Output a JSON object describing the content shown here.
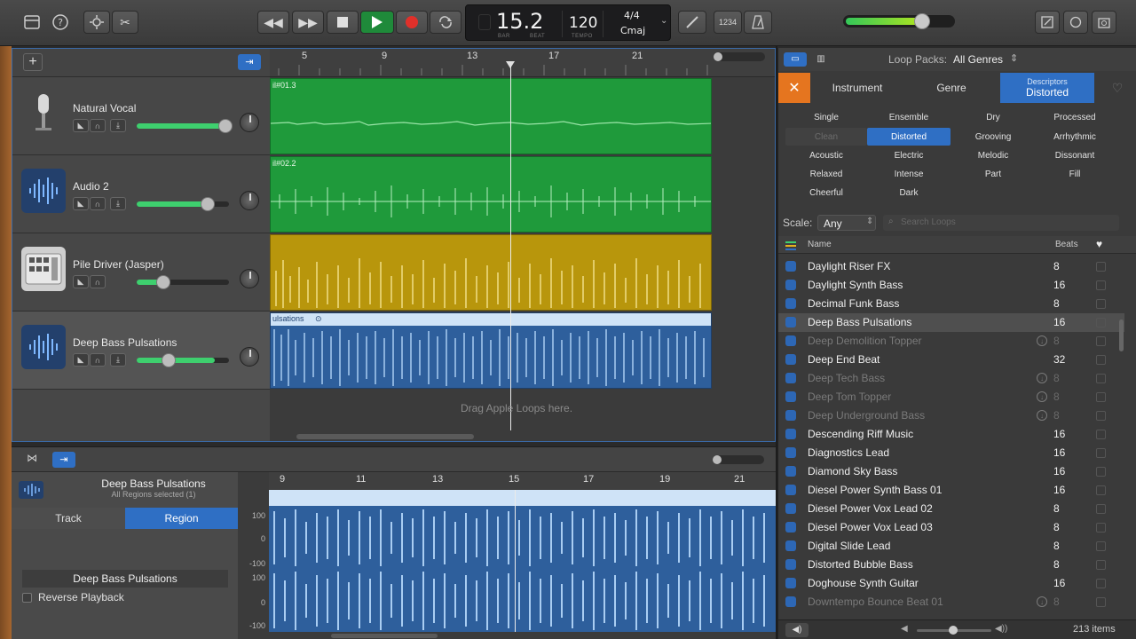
{
  "toolbar": {
    "lcd": {
      "position": "15.2",
      "bar_label": "BAR",
      "beat_label": "BEAT",
      "tempo": "120",
      "tempo_label": "TEMPO",
      "time_signature": "4/4",
      "key": "Cmaj"
    },
    "count_in_label": "1234"
  },
  "tracks": {
    "ruler": [
      "5",
      "9",
      "13",
      "17",
      "21"
    ],
    "items": [
      {
        "name": "Natural Vocal",
        "region": "il#01.3",
        "color": "#1f9a3b"
      },
      {
        "name": "Audio 2",
        "region": "il#02.2",
        "color": "#1f9a3b"
      },
      {
        "name": "Pile Driver (Jasper)",
        "region": "",
        "color": "#b8960c"
      },
      {
        "name": "Deep Bass Pulsations",
        "region": "ulsations",
        "color": "#9dc3ea"
      }
    ],
    "drag_hint": "Drag Apple Loops here."
  },
  "editor": {
    "track_name": "Deep Bass Pulsations",
    "subtitle": "All Regions selected (1)",
    "tab_track": "Track",
    "tab_region": "Region",
    "region_name": "Deep Bass Pulsations",
    "reverse_label": "Reverse Playback",
    "ruler": [
      "9",
      "11",
      "13",
      "15",
      "17",
      "19",
      "21"
    ],
    "db_labels": [
      "100",
      "0",
      "-100",
      "100",
      "0",
      "-100"
    ]
  },
  "browser": {
    "loop_packs_label": "Loop Packs:",
    "loop_packs_value": "All Genres",
    "tab_instrument": "Instrument",
    "tab_genre": "Genre",
    "tab_descriptors_title": "Descriptors",
    "tab_descriptors_value": "Distorted",
    "keywords": [
      [
        "Single",
        "Ensemble",
        "Dry",
        "Processed"
      ],
      [
        "Clean",
        "Distorted",
        "Grooving",
        "Arrhythmic"
      ],
      [
        "Acoustic",
        "Electric",
        "Melodic",
        "Dissonant"
      ],
      [
        "Relaxed",
        "Intense",
        "Part",
        "Fill"
      ],
      [
        "Cheerful",
        "Dark",
        "",
        ""
      ]
    ],
    "scale_label": "Scale:",
    "scale_value": "Any",
    "search_placeholder": "Search Loops",
    "col_name": "Name",
    "col_beats": "Beats",
    "loops": [
      {
        "name": "Daylight Riser FX",
        "beats": "8",
        "dim": false
      },
      {
        "name": "Daylight Synth Bass",
        "beats": "16",
        "dim": false
      },
      {
        "name": "Decimal Funk Bass",
        "beats": "8",
        "dim": false
      },
      {
        "name": "Deep Bass Pulsations",
        "beats": "16",
        "dim": false,
        "selected": true
      },
      {
        "name": "Deep Demolition Topper",
        "beats": "8",
        "dim": true
      },
      {
        "name": "Deep End Beat",
        "beats": "32",
        "dim": false
      },
      {
        "name": "Deep Tech Bass",
        "beats": "8",
        "dim": true
      },
      {
        "name": "Deep Tom Topper",
        "beats": "8",
        "dim": true
      },
      {
        "name": "Deep Underground Bass",
        "beats": "8",
        "dim": true
      },
      {
        "name": "Descending Riff Music",
        "beats": "16",
        "dim": false
      },
      {
        "name": "Diagnostics Lead",
        "beats": "16",
        "dim": false
      },
      {
        "name": "Diamond Sky Bass",
        "beats": "16",
        "dim": false
      },
      {
        "name": "Diesel Power Synth Bass 01",
        "beats": "16",
        "dim": false
      },
      {
        "name": "Diesel Power Vox Lead 02",
        "beats": "8",
        "dim": false
      },
      {
        "name": "Diesel Power Vox Lead 03",
        "beats": "8",
        "dim": false
      },
      {
        "name": "Digital Slide Lead",
        "beats": "8",
        "dim": false
      },
      {
        "name": "Distorted Bubble Bass",
        "beats": "8",
        "dim": false
      },
      {
        "name": "Doghouse Synth Guitar",
        "beats": "16",
        "dim": false
      },
      {
        "name": "Downtempo Bounce Beat 01",
        "beats": "8",
        "dim": true
      }
    ],
    "item_count": "213 items"
  },
  "colors": {
    "accent_blue": "#2f6fc4",
    "record_red": "#e0302a",
    "play_green": "#1f8a3a"
  }
}
